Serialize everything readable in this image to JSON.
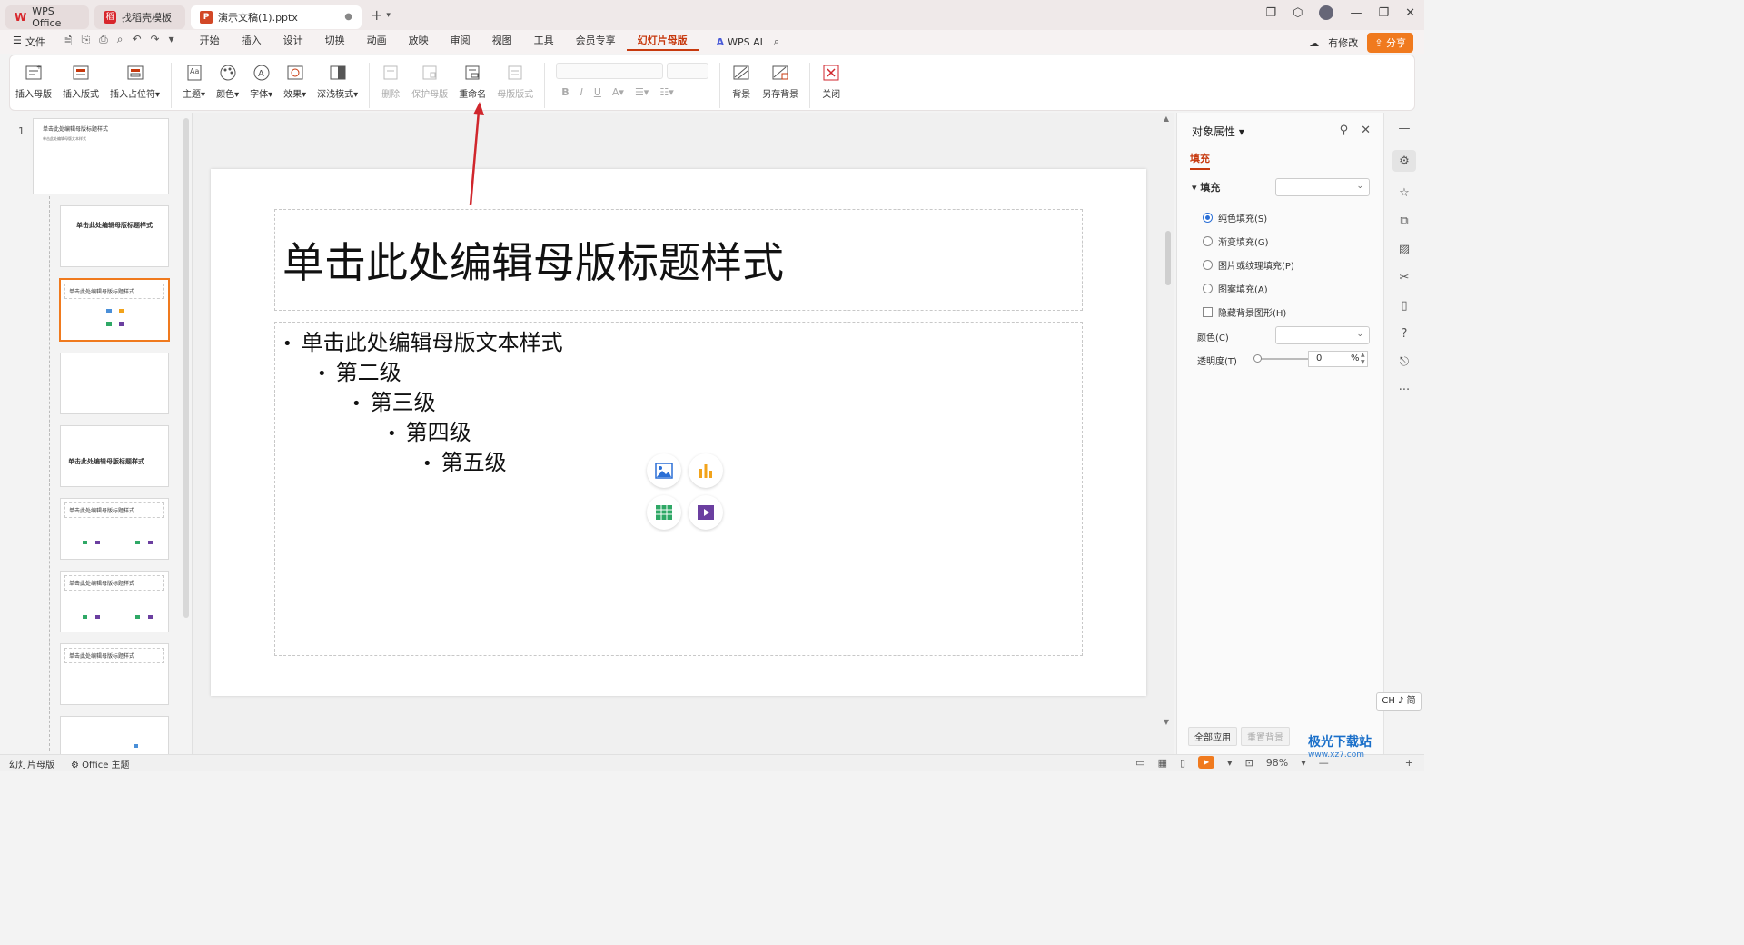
{
  "tabs": {
    "wps": "WPS Office",
    "find": "找稻壳模板",
    "doc": "演示文稿(1).pptx",
    "doc_dot": "●"
  },
  "menu": {
    "file": "文件",
    "items": [
      "开始",
      "插入",
      "设计",
      "切换",
      "动画",
      "放映",
      "审阅",
      "视图",
      "工具",
      "会员专享",
      "幻灯片母版"
    ],
    "active": "幻灯片母版",
    "wps_ai": "WPS AI",
    "has_changes": "有修改",
    "share": "分享"
  },
  "ribbon": {
    "insert_master": "插入母版",
    "insert_layout": "插入版式",
    "insert_placeholder": "插入占位符",
    "theme": "主题",
    "color": "颜色",
    "font": "字体",
    "effect": "效果",
    "depth": "深浅模式",
    "delete": "删除",
    "protect": "保护母版",
    "rename": "重命名",
    "master_layout": "母版版式",
    "background": "背景",
    "save_background": "另存背景",
    "close": "关闭"
  },
  "slide_panel": {
    "number": "1",
    "thumb_title": "单击此处编辑母版标题样式",
    "thumb_body": "单击此处编辑母版文本样式"
  },
  "slide": {
    "title": "单击此处编辑母版标题样式",
    "levels": [
      "单击此处编辑母版文本样式",
      "第二级",
      "第三级",
      "第四级",
      "第五级"
    ]
  },
  "right_pane": {
    "title": "对象属性",
    "tab": "填充",
    "section": "填充",
    "options": [
      "纯色填充(S)",
      "渐变填充(G)",
      "图片或纹理填充(P)",
      "图案填充(A)"
    ],
    "hide_bg": "隐藏背景图形(H)",
    "color_label": "颜色(C)",
    "transparency_label": "透明度(T)",
    "transparency_value": "0",
    "pct": "%",
    "apply_all": "全部应用",
    "reset_bg": "重置背景"
  },
  "ime": "CH ♪ 简",
  "status": {
    "mode": "幻灯片母版",
    "theme": "Office 主题",
    "zoom": "98%"
  },
  "watermark": {
    "name": "极光下载站",
    "url": "www.xz7.com"
  },
  "colors": {
    "accent": "#c7390e",
    "share": "#f07a1e",
    "selected_thumb": "#f07a1e",
    "arrow": "#d0262c"
  }
}
